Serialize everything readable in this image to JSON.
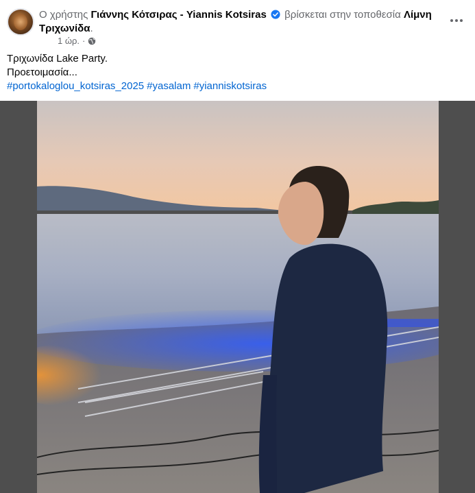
{
  "post": {
    "header": {
      "prefix": "Ο χρήστης ",
      "author": "Γιάννης Κότσιρας - Yiannis Kotsiras",
      "location_prefix": " βρίσκεται στην τοποθεσία ",
      "location": "Λίμνη Τριχωνίδα",
      "suffix": "."
    },
    "meta": {
      "time": "1 ώρ.",
      "separator": "·",
      "audience_icon": "globe-icon"
    },
    "more_icon": "more-options-icon",
    "text": {
      "line1": "Τριχωνίδα Lake Party.",
      "line2": "Προετοιμασία..."
    },
    "hashtags": [
      "#portokaloglou_kotsiras_2025",
      "#yasalam",
      "#yianniskotsiras"
    ]
  },
  "colors": {
    "link": "#0064d1",
    "secondary_text": "#65676b",
    "verified": "#1877f2",
    "media_background": "#4e4e4e"
  }
}
